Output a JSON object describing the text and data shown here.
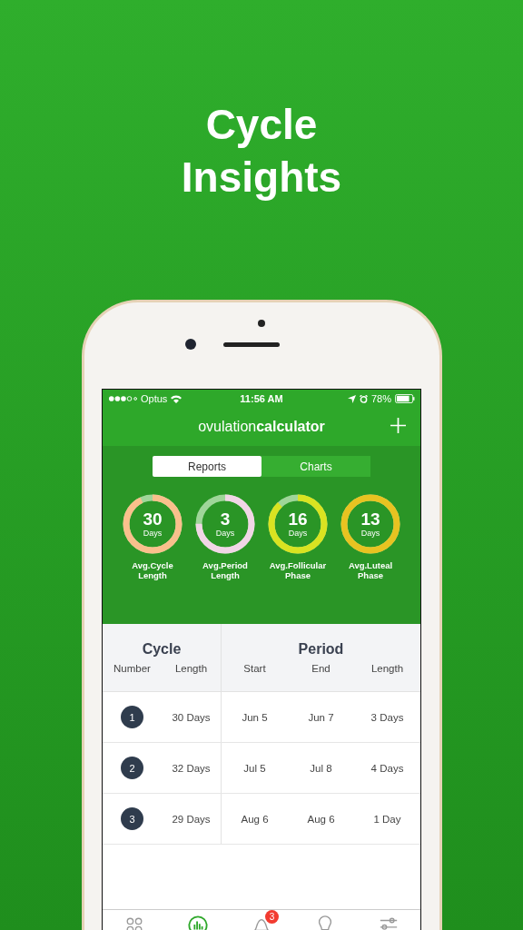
{
  "headline": [
    "Cycle",
    "Insights"
  ],
  "status_bar": {
    "carrier": "Optus",
    "time": "11:56 AM",
    "battery": "78%"
  },
  "header": {
    "logo": "ovulation**calculator**"
  },
  "segments": [
    {
      "label": "Reports",
      "selected": true
    },
    {
      "label": "Charts",
      "selected": false
    }
  ],
  "stats": [
    {
      "value": "30",
      "unit": "Days",
      "label": "Avg.Cycle Length",
      "level": 0.93,
      "color": "#f9c08c"
    },
    {
      "value": "3",
      "unit": "Days",
      "label": "Avg.Period Length",
      "level": 0.75,
      "color": "#f1d6e6"
    },
    {
      "value": "16",
      "unit": "Days",
      "label": "Avg.Follicular Phase",
      "level": 0.88,
      "color": "#d9e321"
    },
    {
      "value": "13",
      "unit": "Days",
      "label": "Avg.Luteal Phase",
      "level": 1,
      "color": "#e8c321"
    }
  ],
  "table": {
    "groups": [
      "Cycle",
      "Period"
    ],
    "columns": [
      "Number",
      "Length",
      "Start",
      "End",
      "Length"
    ],
    "rows": [
      {
        "number": "1",
        "length": "30 Days",
        "start": "Jun 5",
        "end": "Jun 7",
        "period_length": "3 Days"
      },
      {
        "number": "2",
        "length": "32 Days",
        "start": "Jul 5",
        "end": "Jul 8",
        "period_length": "4 Days"
      },
      {
        "number": "3",
        "length": "29 Days",
        "start": "Aug 6",
        "end": "Aug 6",
        "period_length": "1 Day"
      }
    ]
  },
  "tab_bar": [
    {
      "kind": "grid",
      "selected": false
    },
    {
      "kind": "chart",
      "selected": true
    },
    {
      "kind": "bell",
      "selected": false,
      "badge": "3"
    },
    {
      "kind": "bulb",
      "selected": false
    },
    {
      "kind": "sliders",
      "selected": false
    }
  ]
}
